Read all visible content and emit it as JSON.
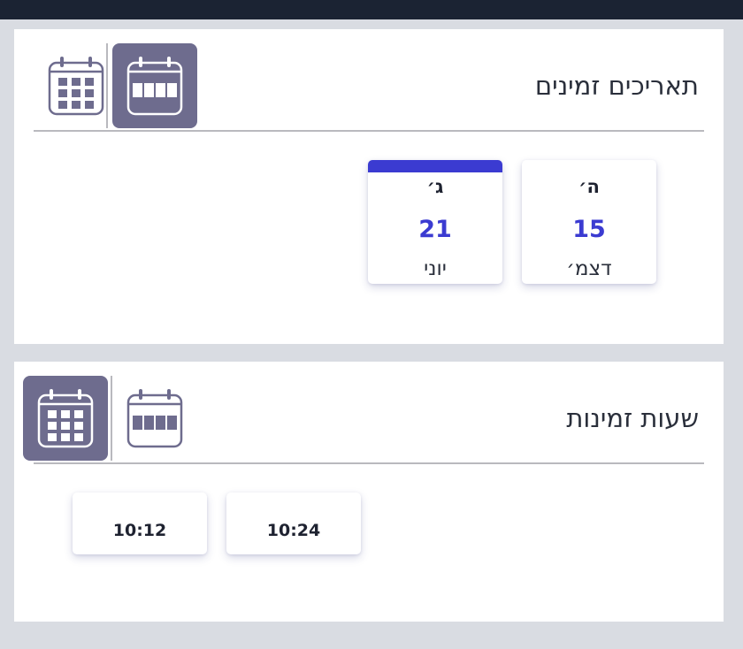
{
  "colors": {
    "topbar": "#1b2333",
    "page_bg": "#d9dce2",
    "accent": "#3b3bd1",
    "toggle_active": "#6e6c8e",
    "icon_stroke": "#6e6c8e"
  },
  "dates_panel": {
    "title": "תאריכים זמינים",
    "view_toggle": {
      "strip_view_icon": "calendar-strip-icon",
      "grid_view_icon": "calendar-grid-icon",
      "active": "strip"
    },
    "dates": [
      {
        "dow": "ה׳",
        "day": "15",
        "month": "דצמ׳",
        "selected": false
      },
      {
        "dow": "ג׳",
        "day": "21",
        "month": "יוני",
        "selected": true
      }
    ]
  },
  "times_panel": {
    "title": "שעות זמינות",
    "view_toggle": {
      "strip_view_icon": "calendar-strip-icon",
      "grid_view_icon": "calendar-grid-icon",
      "active": "grid"
    },
    "times": [
      {
        "label": "10:24"
      },
      {
        "label": "10:12"
      }
    ]
  }
}
